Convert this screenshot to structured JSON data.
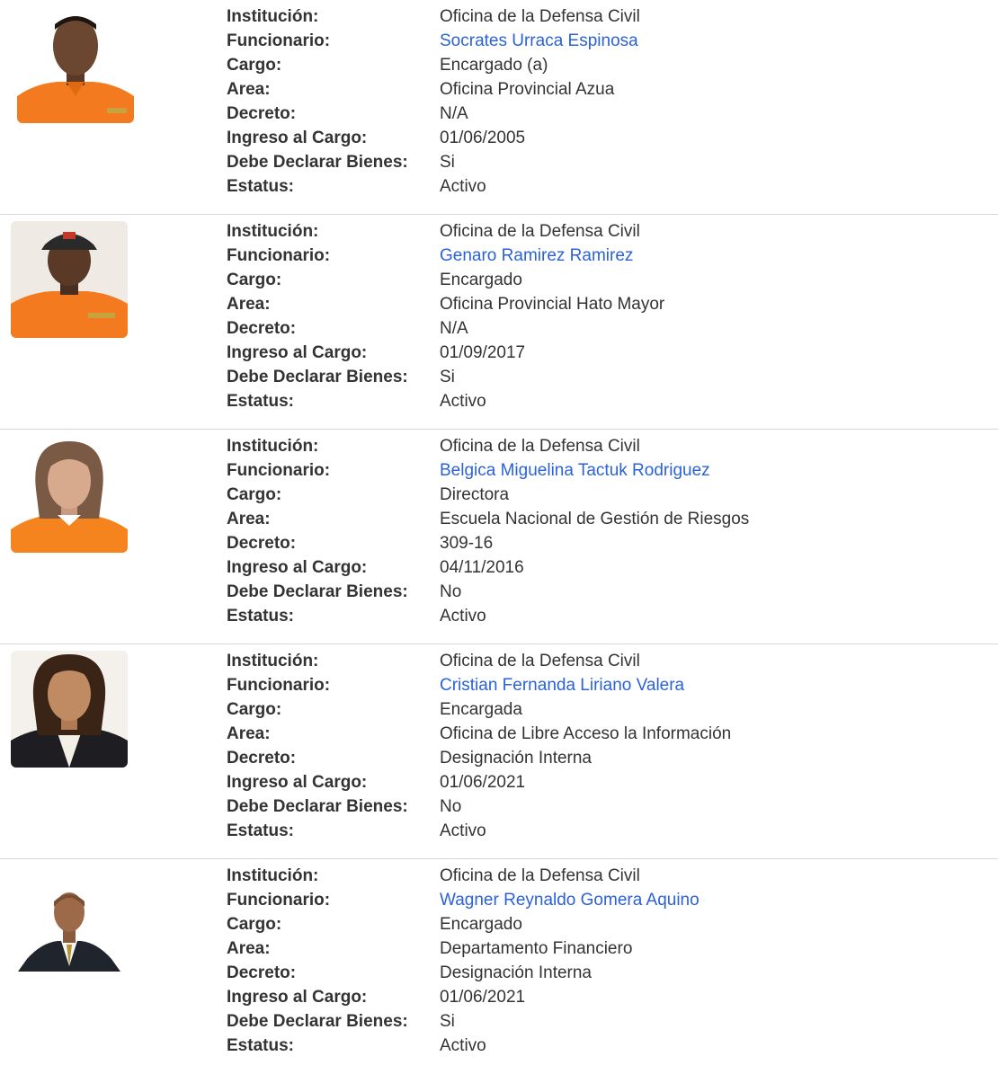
{
  "labels": {
    "institucion": "Institución:",
    "funcionario": "Funcionario:",
    "cargo": "Cargo:",
    "area": "Area:",
    "decreto": "Decreto:",
    "ingreso": "Ingreso al Cargo:",
    "declarar": "Debe Declarar Bienes:",
    "estatus": "Estatus:"
  },
  "colors": {
    "link": "#2b62d8",
    "uniform_orange": "#f47a1f",
    "divider": "#d8d8d8"
  },
  "records": [
    {
      "institucion": "Oficina de la Defensa Civil",
      "funcionario": "Socrates Urraca Espinosa",
      "cargo": "Encargado (a)",
      "area": "Oficina Provincial Azua",
      "decreto": "N/A",
      "ingreso": "01/06/2005",
      "declarar": "Si",
      "estatus": "Activo"
    },
    {
      "institucion": "Oficina de la Defensa Civil",
      "funcionario": "Genaro Ramirez Ramirez",
      "cargo": "Encargado",
      "area": "Oficina Provincial Hato Mayor",
      "decreto": "N/A",
      "ingreso": "01/09/2017",
      "declarar": "Si",
      "estatus": "Activo"
    },
    {
      "institucion": "Oficina de la Defensa Civil",
      "funcionario": "Belgica Miguelina Tactuk Rodriguez",
      "cargo": "Directora",
      "area": "Escuela Nacional de Gestión de Riesgos",
      "decreto": "309-16",
      "ingreso": "04/11/2016",
      "declarar": "No",
      "estatus": "Activo"
    },
    {
      "institucion": "Oficina de la Defensa Civil",
      "funcionario": "Cristian Fernanda Liriano Valera",
      "cargo": "Encargada",
      "area": "Oficina de Libre Acceso la Información",
      "decreto": "Designación Interna",
      "ingreso": "01/06/2021",
      "declarar": "No",
      "estatus": "Activo"
    },
    {
      "institucion": "Oficina de la Defensa Civil",
      "funcionario": "Wagner Reynaldo Gomera Aquino",
      "cargo": "Encargado",
      "area": "Departamento Financiero",
      "decreto": "Designación Interna",
      "ingreso": "01/06/2021",
      "declarar": "Si",
      "estatus": "Activo"
    }
  ]
}
